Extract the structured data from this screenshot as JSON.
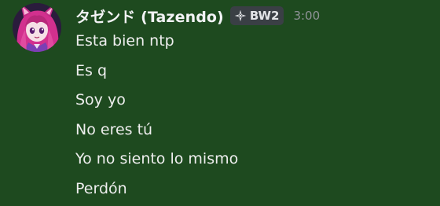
{
  "message": {
    "author": {
      "display_name": "タゼンド (Tazendo)",
      "avatar_icon": "anime-character-avatar",
      "clan_tag": {
        "icon": "sparkle-diamond-icon",
        "label": "BW2"
      }
    },
    "timestamp": "3:00",
    "lines": [
      "Esta bien ntp",
      "Es q",
      "Soy yo",
      "No eres tú",
      "Yo no siento lo mismo",
      "Perdón"
    ]
  },
  "colors": {
    "background": "#1e4a1f",
    "username": "#f2f3f5",
    "message_text": "#eeeeee",
    "timestamp": "#8e9297",
    "clan_tag_bg": "#3a3f45"
  }
}
